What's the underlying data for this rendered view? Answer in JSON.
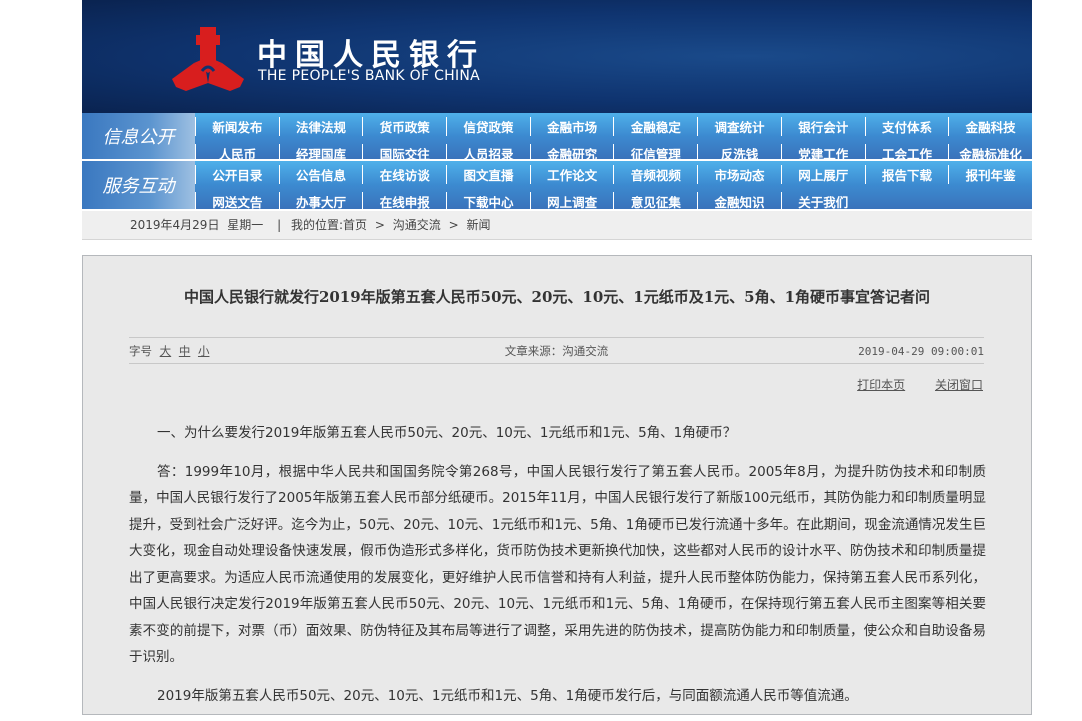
{
  "header": {
    "name_cn": "中国人民银行",
    "name_en": "THE PEOPLE'S BANK OF CHINA",
    "logo_color": "#d81e1e"
  },
  "nav": [
    {
      "label": "信息公开",
      "items": [
        "新闻发布",
        "法律法规",
        "货币政策",
        "信贷政策",
        "金融市场",
        "金融稳定",
        "调查统计",
        "银行会计",
        "支付体系",
        "金融科技",
        "人民币",
        "经理国库",
        "国际交往",
        "人员招录",
        "金融研究",
        "征信管理",
        "反洗钱",
        "党建工作",
        "工会工作",
        "金融标准化"
      ]
    },
    {
      "label": "服务互动",
      "items": [
        "公开目录",
        "公告信息",
        "在线访谈",
        "图文直播",
        "工作论文",
        "音频视频",
        "市场动态",
        "网上展厅",
        "报告下载",
        "报刊年鉴",
        "网送文告",
        "办事大厅",
        "在线申报",
        "下载中心",
        "网上调查",
        "意见征集",
        "金融知识",
        "关于我们"
      ]
    }
  ],
  "breadcrumb": {
    "date": "2019年4月29日",
    "weekday": "星期一",
    "sep": "|",
    "location_label": "我的位置:",
    "items": [
      "首页",
      "沟通交流",
      "新闻"
    ],
    "arrow": ">"
  },
  "article": {
    "title": "中国人民银行就发行2019年版第五套人民币50元、20元、10元、1元纸币及1元、5角、1角硬币事宜答记者问",
    "font_label": "字号",
    "font_sizes": [
      "大",
      "中",
      "小"
    ],
    "source": "文章来源：沟通交流",
    "datetime": "2019-04-29 09:00:01",
    "print": "打印本页",
    "close": "关闭窗口",
    "paragraphs": [
      "一、为什么要发行2019年版第五套人民币50元、20元、10元、1元纸币和1元、5角、1角硬币？",
      "答：1999年10月，根据中华人民共和国国务院令第268号，中国人民银行发行了第五套人民币。2005年8月，为提升防伪技术和印制质量，中国人民银行发行了2005年版第五套人民币部分纸硬币。2015年11月，中国人民银行发行了新版100元纸币，其防伪能力和印制质量明显提升，受到社会广泛好评。迄今为止，50元、20元、10元、1元纸币和1元、5角、1角硬币已发行流通十多年。在此期间，现金流通情况发生巨大变化，现金自动处理设备快速发展，假币伪造形式多样化，货币防伪技术更新换代加快，这些都对人民币的设计水平、防伪技术和印制质量提出了更高要求。为适应人民币流通使用的发展变化，更好维护人民币信誉和持有人利益，提升人民币整体防伪能力，保持第五套人民币系列化，中国人民银行决定发行2019年版第五套人民币50元、20元、10元、1元纸币和1元、5角、1角硬币，在保持现行第五套人民币主图案等相关要素不变的前提下，对票（币）面效果、防伪特征及其布局等进行了调整，采用先进的防伪技术，提高防伪能力和印制质量，使公众和自助设备易于识别。",
      "2019年版第五套人民币50元、20元、10元、1元纸币和1元、5角、1角硬币发行后，与同面额流通人民币等值流通。"
    ]
  }
}
